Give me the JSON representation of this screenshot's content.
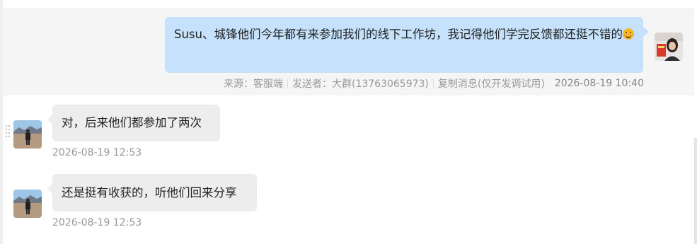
{
  "outgoing": {
    "text": "Susu、城锋他们今年都有来参加我们的线下工作坊，我记得他们学完反馈都还挺不错的",
    "emoji": "smiling-face-emoji",
    "meta": {
      "source": "来源：客服端",
      "sender": "发送者：大群(13763065973)",
      "copy": "复制消息(仅开发调试用)",
      "time": "2026-08-19 10:40"
    }
  },
  "incoming": [
    {
      "text": "对，后来他们都参加了两次",
      "time": "2026-08-19 12:53"
    },
    {
      "text": "还是挺有收获的，听他们回来分享",
      "time": "2026-08-19 12:53"
    }
  ],
  "colors": {
    "outgoing_bubble": "#c5e1fb",
    "incoming_bubble": "#ededed",
    "meta_text": "#999999"
  }
}
